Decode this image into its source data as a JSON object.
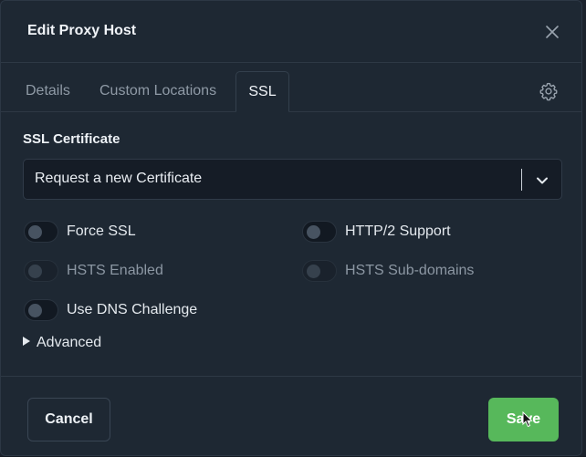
{
  "modal": {
    "title": "Edit Proxy Host",
    "close_icon": "close-icon"
  },
  "tabs": [
    {
      "label": "Details",
      "active": false
    },
    {
      "label": "Custom Locations",
      "active": false
    },
    {
      "label": "SSL",
      "active": true
    }
  ],
  "settings_icon": "gear-icon",
  "ssl": {
    "section_label": "SSL Certificate",
    "certificate_select": {
      "selected": "Request a new Certificate",
      "icon": "chevron-down-icon"
    },
    "toggles": [
      {
        "label": "Force SSL",
        "enabled": true,
        "checked": false
      },
      {
        "label": "HTTP/2 Support",
        "enabled": true,
        "checked": false
      },
      {
        "label": "HSTS Enabled",
        "enabled": false,
        "checked": false
      },
      {
        "label": "HSTS Sub-domains",
        "enabled": false,
        "checked": false
      },
      {
        "label": "Use DNS Challenge",
        "enabled": true,
        "checked": false
      }
    ],
    "advanced_label": "Advanced"
  },
  "footer": {
    "cancel_label": "Cancel",
    "save_label": "Save"
  },
  "colors": {
    "modal_bg": "#1e2833",
    "input_bg": "#151c26",
    "accent_green": "#57b85b",
    "text_primary": "#e8edf2",
    "text_muted": "#8f9aa6"
  }
}
